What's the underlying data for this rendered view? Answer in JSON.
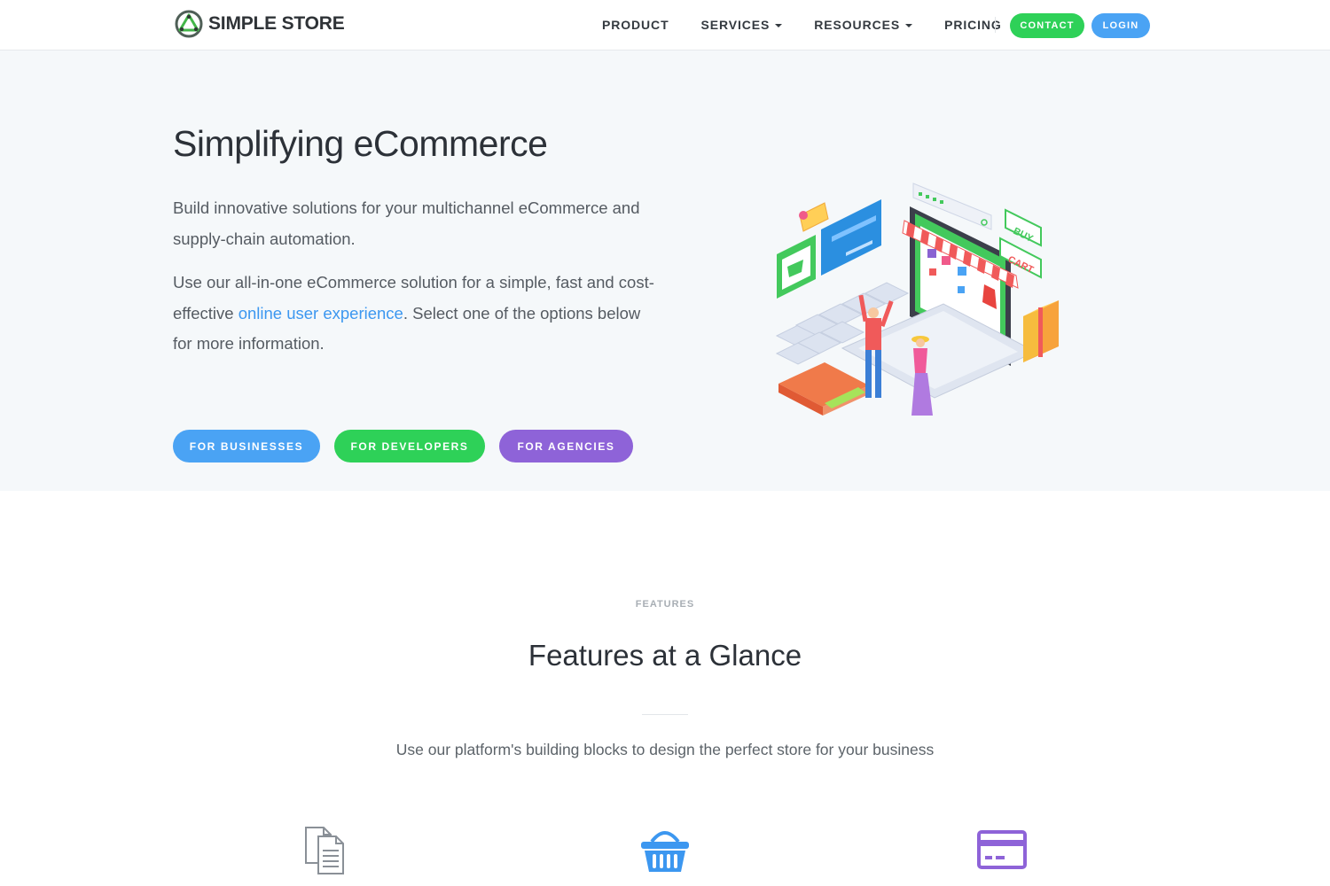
{
  "nav": {
    "brand": "SIMPLE STORE",
    "items": [
      {
        "label": "PRODUCT",
        "dropdown": false
      },
      {
        "label": "SERVICES",
        "dropdown": true
      },
      {
        "label": "RESOURCES",
        "dropdown": true
      },
      {
        "label": "PRICING",
        "dropdown": false
      }
    ],
    "contact_label": "CONTACT",
    "login_label": "LOGIN"
  },
  "hero": {
    "title": "Simplifying eCommerce",
    "paragraph1": "Build innovative solutions for your multichannel eCommerce and supply-chain automation.",
    "paragraph2_before": "Use our all-in-one eCommerce solution for a simple, fast and cost-effective ",
    "paragraph2_link": "online user experience",
    "paragraph2_after": ". Select one of the options below for more information.",
    "illustration_labels": {
      "buy": "BUY",
      "cart": "CART"
    },
    "buttons": {
      "businesses": "FOR BUSINESSES",
      "developers": "FOR DEVELOPERS",
      "agencies": "FOR AGENCIES"
    }
  },
  "features": {
    "eyebrow": "FEATURES",
    "title": "Features at a Glance",
    "subtitle": "Use our platform's building blocks to design the perfect store for your business",
    "icons": [
      "document-icon",
      "shopping-basket-icon",
      "credit-card-icon"
    ]
  },
  "colors": {
    "blue": "#4aa3f4",
    "green": "#2ed158",
    "purple": "#8e63d8",
    "hero_bg": "#f5f8fa",
    "link": "#3c97f0"
  }
}
